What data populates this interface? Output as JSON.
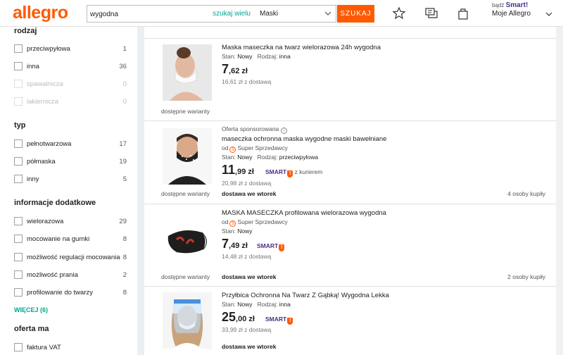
{
  "header": {
    "logo": "allegro",
    "search_value": "wygodna",
    "search_within": "szukaj wielu",
    "category": "Maski",
    "search_button": "SZUKAJ",
    "smart_prefix": "bądź",
    "smart_brand": "Smart!",
    "account": "Moje Allegro"
  },
  "sidebar": {
    "groups": [
      {
        "heading": "rodzaj",
        "options": [
          {
            "label": "przeciwpyłowa",
            "count": "1"
          },
          {
            "label": "inna",
            "count": "36"
          },
          {
            "label": "spawalnicza",
            "count": "0"
          },
          {
            "label": "lakiernicza",
            "count": "0"
          }
        ]
      },
      {
        "heading": "typ",
        "options": [
          {
            "label": "pełnotwarzowa",
            "count": "17"
          },
          {
            "label": "półmaska",
            "count": "19"
          },
          {
            "label": "inny",
            "count": "5"
          }
        ]
      },
      {
        "heading": "informacje dodatkowe",
        "options": [
          {
            "label": "wielorazowa",
            "count": "29"
          },
          {
            "label": "mocowanie na gumki",
            "count": "8"
          },
          {
            "label": "możliwość regulacji mocowania",
            "count": "8"
          },
          {
            "label": "możliwość prania",
            "count": "2"
          },
          {
            "label": "profilowanie do twarzy",
            "count": "8"
          }
        ],
        "more": "WIĘCEJ (6)"
      },
      {
        "heading": "oferta ma",
        "options": [
          {
            "label": "faktura VAT",
            "count": ""
          }
        ]
      }
    ]
  },
  "listing": {
    "items": [
      {
        "title": "Maska maseczka na twarz wielorazowa 24h wygodna",
        "state_label": "Stan:",
        "state": "Nowy",
        "type_label": "Rodzaj:",
        "type": "inna",
        "price_main": "7",
        "price_dec": ",62 zł",
        "shipping": "16,61 zł z dostawą",
        "variants": "dostępne warianty"
      },
      {
        "sponsored": "Oferta sponsorowana",
        "title": "maseczka ochronna maska wygodne maski bawełniane",
        "seller_prefix": "od",
        "seller": "Super Sprzedawcy",
        "state_label": "Stan:",
        "state": "Nowy",
        "type_label": "Rodzaj:",
        "type": "przeciwpyłowa",
        "price_main": "11",
        "price_dec": ",99 zł",
        "smart": "SMART",
        "courier": "z kurierem",
        "shipping": "20,98 zł z dostawą",
        "delivery": "dostawa we wtorek",
        "buyers": "4 osoby kupiły",
        "variants": "dostępne warianty"
      },
      {
        "title": "MASKA MASECZKA profilowana wielorazowa wygodna",
        "seller_prefix": "od",
        "seller": "Super Sprzedawcy",
        "state_label": "Stan:",
        "state": "Nowy",
        "price_main": "7",
        "price_dec": ",49 zł",
        "smart": "SMART",
        "shipping": "14,48 zł z dostawą",
        "delivery": "dostawa we wtorek",
        "buyers": "2 osoby kupiły",
        "variants": "dostępne warianty"
      },
      {
        "title": "Przyłbica Ochronna Na Twarz Z Gąbką! Wygodna Lekka",
        "state_label": "Stan:",
        "state": "Nowy",
        "type_label": "Rodzaj:",
        "type": "inna",
        "price_main": "25",
        "price_dec": ",00 zł",
        "smart": "SMART",
        "shipping": "33,99 zł z dostawą",
        "delivery": "dostawa we wtorek"
      }
    ]
  }
}
